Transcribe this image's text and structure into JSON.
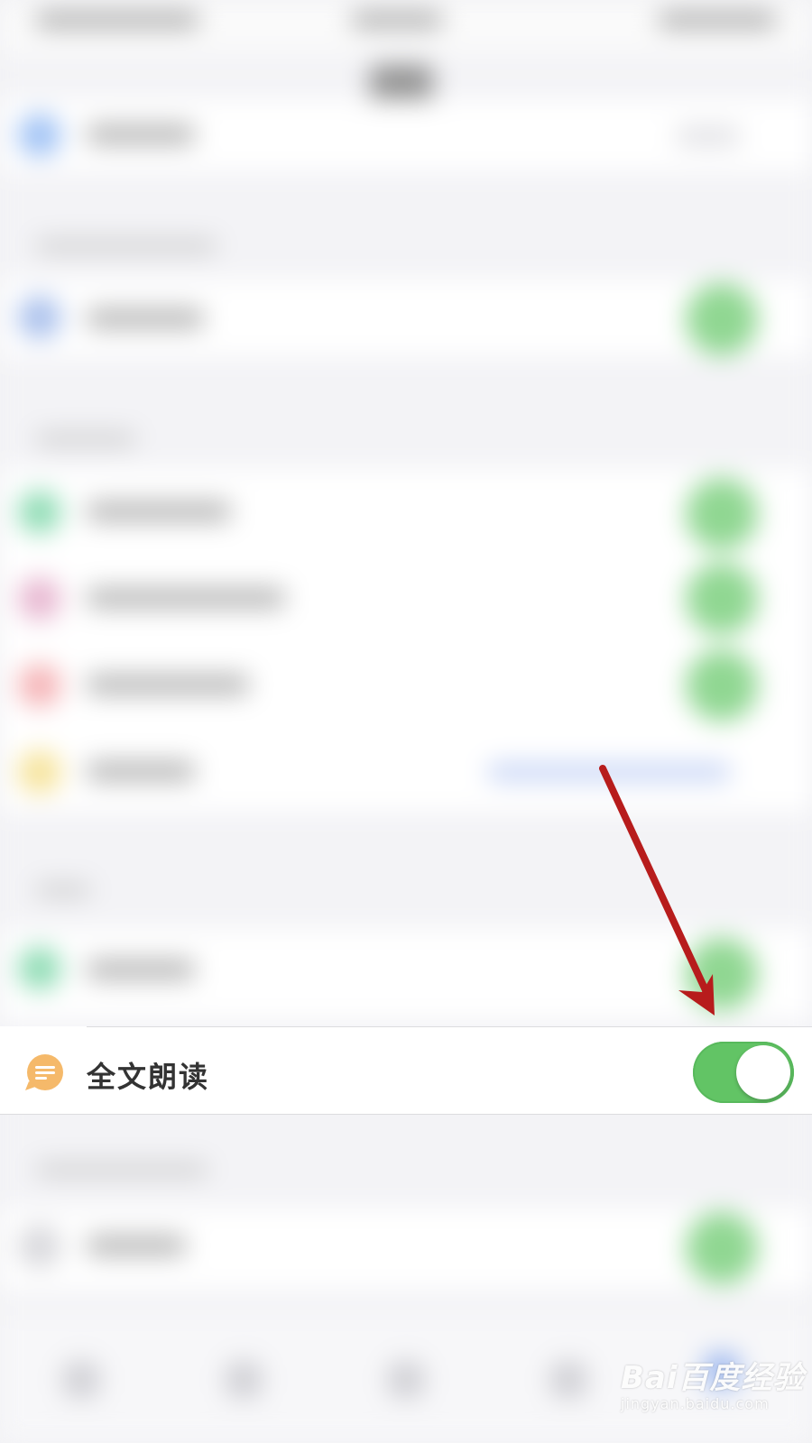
{
  "setting_row": {
    "label": "全文朗读",
    "icon": "chat-bubble-icon",
    "icon_color": "#f5b96a",
    "toggle_on": true,
    "toggle_color": "#62c465"
  },
  "annotation": {
    "arrow_color": "#b71c1c",
    "points_to": "read-aloud-toggle"
  },
  "watermark": {
    "brand": "Bai百度经验",
    "url": "jingyan.baidu.com"
  }
}
